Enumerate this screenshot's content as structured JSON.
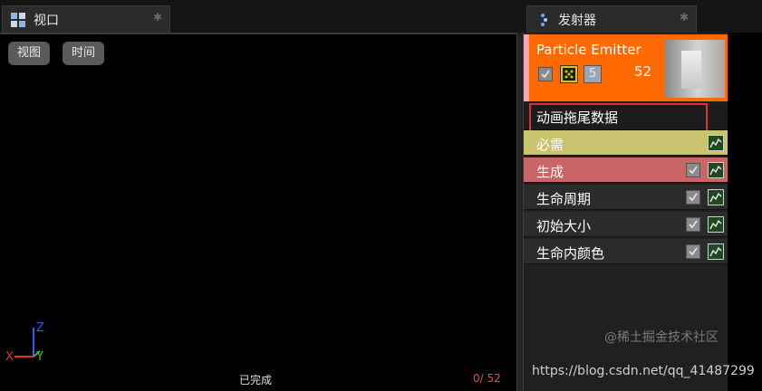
{
  "tabs": {
    "viewport": {
      "label": "视口",
      "close": "✱"
    },
    "emitter": {
      "label": "发射器",
      "close": "✱"
    }
  },
  "viewport": {
    "buttons": {
      "view": "视图",
      "time": "时间"
    },
    "axis": {
      "z": "Z",
      "x": "X",
      "y": "Y"
    },
    "status": "已完成",
    "counter": "0/  52"
  },
  "emitter": {
    "title": "Particle Emitter",
    "count": "52",
    "lod_label": "5",
    "modules": [
      {
        "label": "动画拖尾数据"
      },
      {
        "label": "必需"
      },
      {
        "label": "生成"
      },
      {
        "label": "生命周期"
      },
      {
        "label": "初始大小"
      },
      {
        "label": "生命内颜色"
      }
    ]
  },
  "watermark": "https://blog.csdn.net/qq_41487299",
  "watermark_site": "@稀土掘金技术社区",
  "colors": {
    "emitter_header": "#ff6a00",
    "required": "#c9c26e",
    "spawn": "#c96565",
    "highlight": "#e03030"
  }
}
